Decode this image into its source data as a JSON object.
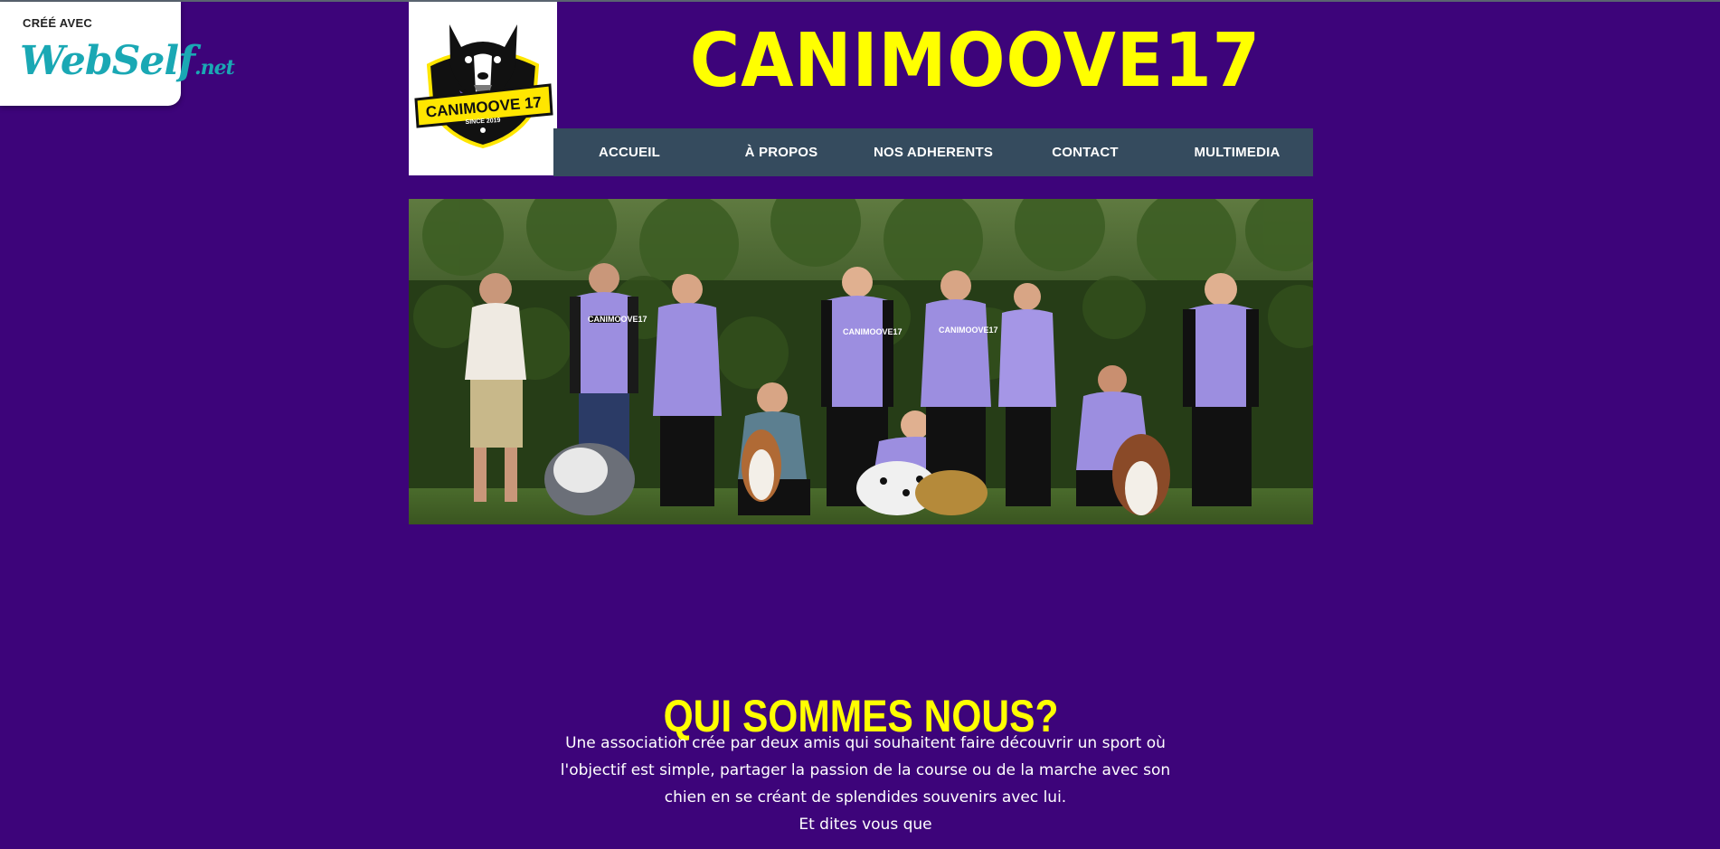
{
  "badge": {
    "created_with": "CRÉÉ AVEC",
    "brand": "WebSelf",
    "brand_suffix": ".net"
  },
  "logo": {
    "text": "CANIMOOVE 17",
    "since": "SINCE 2019"
  },
  "site": {
    "title": "CANIMOOVE17"
  },
  "nav": {
    "items": [
      "ACCUEIL",
      "À PROPOS",
      "NOS ADHERENTS",
      "CONTACT",
      "MULTIMEDIA"
    ]
  },
  "hero": {
    "jacket_label": "CANIMOOVE17"
  },
  "section": {
    "title": "QUI SOMMES NOUS?",
    "lines": [
      "Une association crée par deux amis qui souhaitent faire découvrir un sport où",
      "l'objectif est simple, partager la passion de la course ou de la marche avec son",
      "chien en se créant de splendides souvenirs avec lui.",
      "Et dites vous que"
    ]
  },
  "colors": {
    "background": "#3d047a",
    "accent": "#ffff00",
    "nav_bg": "#354b5e",
    "brand": "#1aa8b4"
  }
}
